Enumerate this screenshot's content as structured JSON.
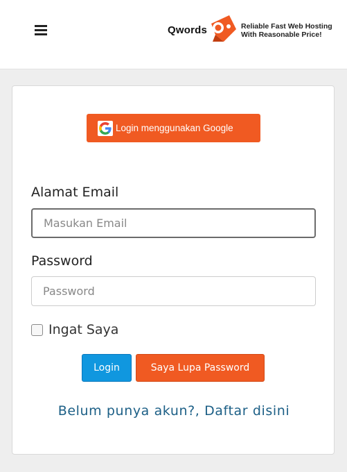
{
  "header": {
    "brand_name": "Qwords",
    "tagline_line1": "Reliable Fast Web Hosting",
    "tagline_line2": "With Reasonable Price!"
  },
  "login_form": {
    "google_button_label": "Login menggunakan Google",
    "email_label": "Alamat Email",
    "email_placeholder": "Masukan Email",
    "email_value": "",
    "password_label": "Password",
    "password_placeholder": "Password",
    "password_value": "",
    "remember_label": "Ingat Saya",
    "remember_checked": false,
    "login_button_label": "Login",
    "forgot_button_label": "Saya Lupa Password",
    "register_link_text": "Belum punya akun?, Daftar disini"
  },
  "icons": {
    "menu": "hamburger-menu-icon",
    "google": "google-g-icon",
    "logo": "qwords-logo-icon"
  },
  "colors": {
    "accent_orange": "#f05a22",
    "primary_blue": "#1097df",
    "link_blue": "#1c5f86",
    "page_background": "#eeeeee"
  }
}
